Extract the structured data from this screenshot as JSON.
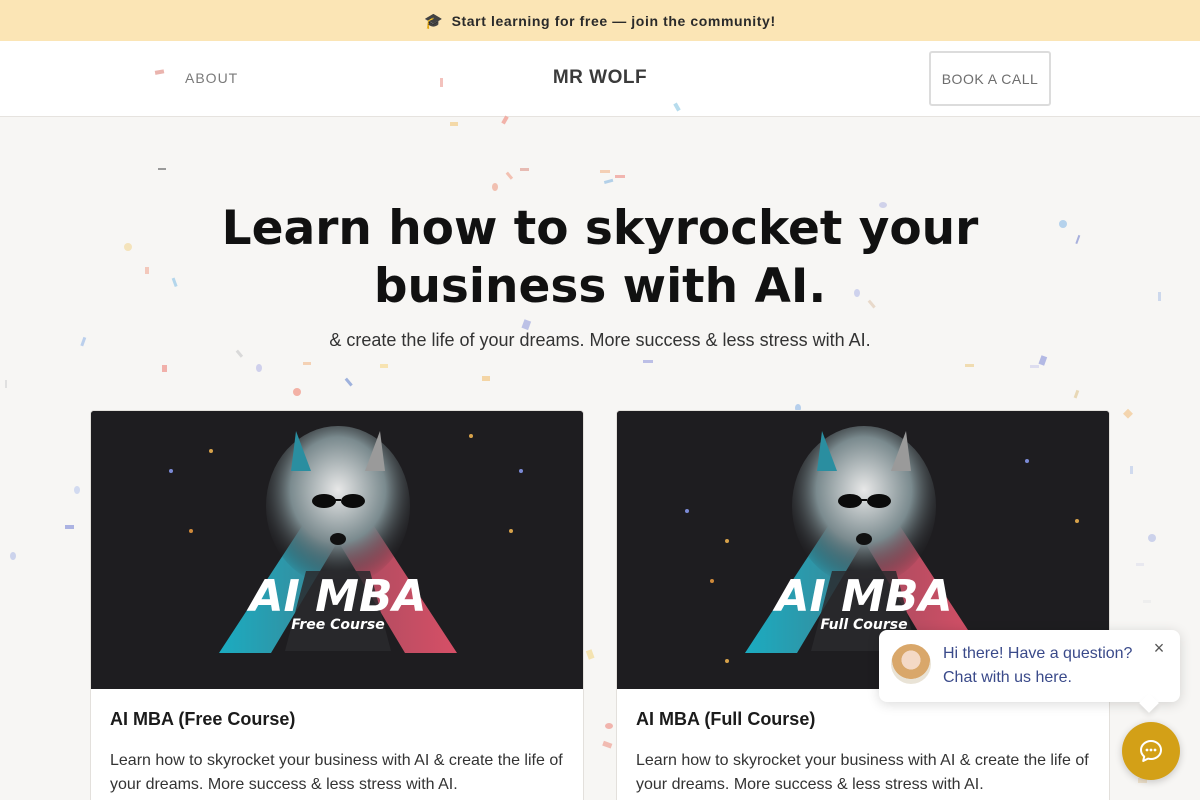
{
  "announcement": {
    "icon": "graduation-cap-icon",
    "text": "Start learning for free — join the community!"
  },
  "nav": {
    "about": "ABOUT",
    "brand": "MR WOLF",
    "book_call": "BOOK A CALL"
  },
  "hero": {
    "title_line1": "Learn how to skyrocket your",
    "title_line2": "business with AI.",
    "subtitle": "& create the life of your dreams. More success & less stress with AI."
  },
  "courses": [
    {
      "thumb_title": "AI MBA",
      "thumb_subtitle": "Free Course",
      "title": "AI MBA (Free Course)",
      "description": "Learn how to skyrocket your business with AI & create the life of your dreams. More success & less stress with AI."
    },
    {
      "thumb_title": "AI MBA",
      "thumb_subtitle": "Full Course",
      "title": "AI MBA (Full Course)",
      "description": "Learn how to skyrocket your business with AI & create the life of your dreams. More success & less stress with AI."
    }
  ],
  "chat": {
    "message": "Hi there! Have a question? Chat with us here.",
    "close_icon": "close-icon",
    "launcher_icon": "chat-bubble-icon"
  },
  "colors": {
    "announcement_bg": "#fbe5b5",
    "chat_button": "#d3a017",
    "page_bg": "#f7f6f4"
  }
}
